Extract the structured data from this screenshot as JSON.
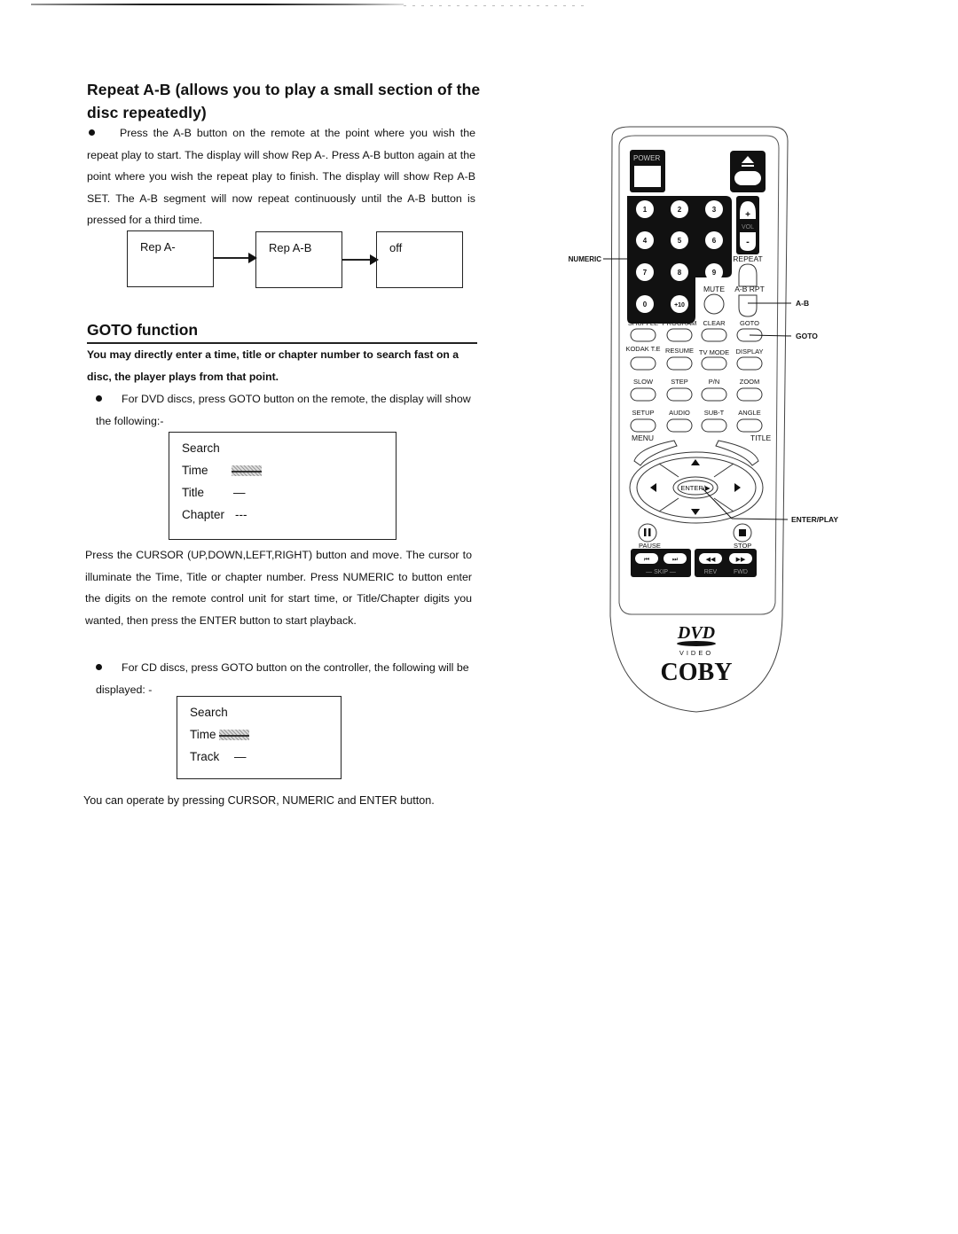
{
  "repeat_section": {
    "heading": "Repeat A-B (allows you to play a small section of the disc repeatedly)",
    "paragraph": "Press the A-B button on the remote at the point where you wish the repeat play to start. The display will show Rep A-. Press A-B button again at the point where you wish the repeat play to finish. The display will show Rep A-B SET. The A-B segment will now repeat continuously until the A-B button is pressed for a third time.",
    "flow_boxes": [
      "Rep A-",
      "Rep A-B",
      "off"
    ]
  },
  "goto_section": {
    "heading": "GOTO function",
    "intro_bold": "You may directly enter a time, title or chapter number to search fast on a disc, the player plays from that point.",
    "dvd_bullet": "For DVD discs, press GOTO button on the remote, the  display will show the following:-",
    "dvd_display": {
      "rows": [
        {
          "label": "Search",
          "value": ""
        },
        {
          "label": "Time",
          "value": "--:--:--"
        },
        {
          "label": "Title",
          "value": "—"
        },
        {
          "label": "Chapter",
          "value": "---"
        }
      ]
    },
    "cursor_paragraph": "Press the CURSOR (UP,DOWN,LEFT,RIGHT) button and move. The cursor to illuminate the Time, Title or chapter number. Press NUMERIC to button enter the digits on the remote control unit for start time, or Title/Chapter digits you wanted, then press the ENTER button to start playback.",
    "cd_bullet": "For  CD discs, press GOTO button on the controller, the   following will be displayed: -",
    "cd_display": {
      "rows": [
        {
          "label": "Search",
          "value": ""
        },
        {
          "label": "Time",
          "value": "--:--"
        },
        {
          "label": "Track",
          "value": "—"
        }
      ]
    },
    "footer_note": "You can operate by pressing CURSOR, NUMERIC and ENTER button."
  },
  "remote": {
    "power_label": "POWER",
    "eject_icon": "eject-icon",
    "numeric_keys": [
      "1",
      "2",
      "3",
      "4",
      "5",
      "6",
      "7",
      "8",
      "9",
      "0",
      "+10"
    ],
    "vol_plus": "+",
    "vol_label": "VOL",
    "vol_minus": "-",
    "repeat_label": "REPEAT",
    "mute_label": "MUTE",
    "ab_rpt_label": "A-B RPT",
    "row_buttons": [
      [
        "SHUFFLE",
        "PROGRAM",
        "CLEAR",
        "GOTO"
      ],
      [
        "KODAK T.E",
        "RESUME",
        "TV MODE",
        "DISPLAY"
      ],
      [
        "SLOW",
        "STEP",
        "P/N",
        "ZOOM"
      ],
      [
        "SETUP",
        "AUDIO",
        "SUB-T",
        "ANGLE"
      ]
    ],
    "menu_label": "MENU",
    "title_label": "TITLE",
    "enter_label": "ENTER/▶",
    "pause_label": "PAUSE",
    "stop_label": "STOP",
    "skip_label": "— SKIP —",
    "rev_label": "REV",
    "fwd_label": "FWD",
    "brand_dvd": "DVD",
    "brand_video": "VIDEO",
    "brand_name": "COBY",
    "callouts": {
      "numeric": "NUMERIC",
      "ab": "A-B",
      "goto": "GOTO",
      "enter_play": "ENTER/PLAY"
    }
  }
}
